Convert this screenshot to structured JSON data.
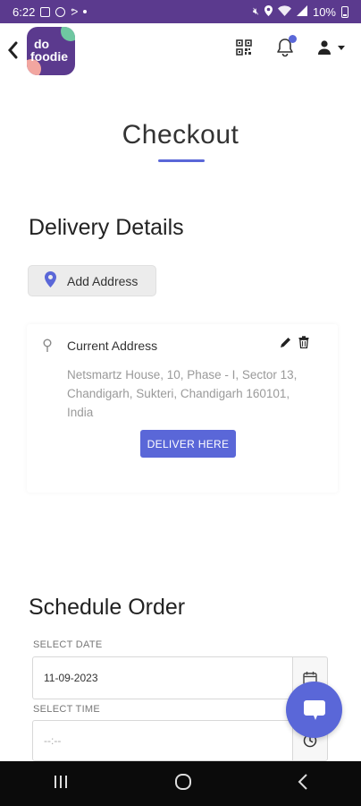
{
  "status_bar": {
    "time": "6:22",
    "battery": "10%"
  },
  "header": {
    "logo_text_line1": "do",
    "logo_text_line2": "foodie"
  },
  "page": {
    "title": "Checkout"
  },
  "delivery": {
    "heading": "Delivery Details",
    "add_address_label": "Add Address",
    "card": {
      "label": "Current Address",
      "address": "Netsmartz House, 10, Phase - I, Sector 13, Chandigarh, Sukteri, Chandigarh 160101, India",
      "deliver_button": "DELIVER HERE"
    }
  },
  "schedule": {
    "heading": "Schedule Order",
    "date_label": "SELECT DATE",
    "date_value": "11-09-2023",
    "time_label": "SELECT TIME",
    "time_placeholder": "--:--"
  },
  "colors": {
    "status_bar": "#5b3a8e",
    "accent": "#5a67d8",
    "nav_bar": "#0b0b0b"
  },
  "icons": {
    "back": "chevron-left-icon",
    "qr": "qr-code-icon",
    "notifications": "bell-icon",
    "user": "user-icon",
    "pin": "map-pin-icon",
    "edit": "pencil-icon",
    "delete": "trash-icon",
    "calendar": "calendar-icon",
    "clock": "clock-icon",
    "chat": "chat-bubble-icon"
  }
}
